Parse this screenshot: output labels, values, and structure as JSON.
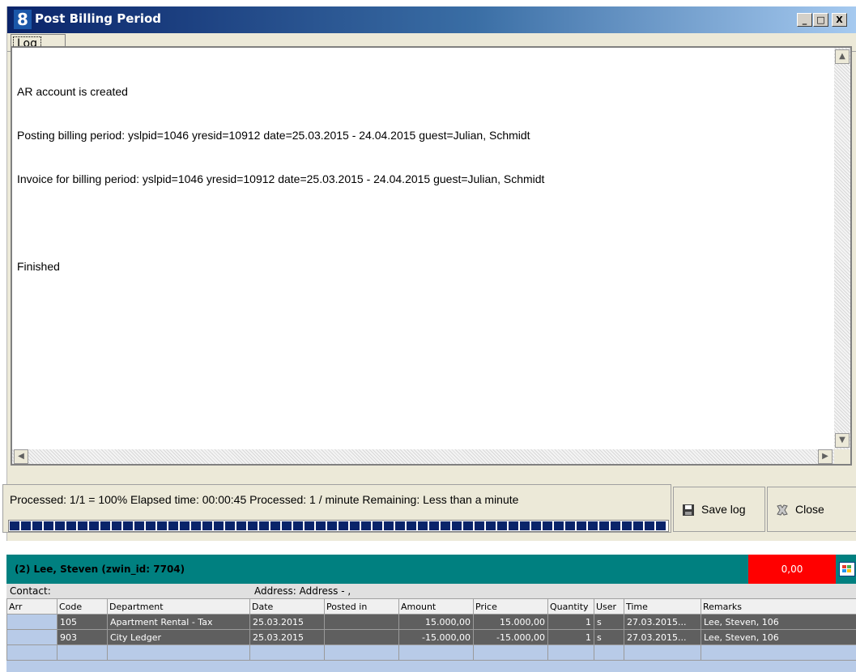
{
  "window": {
    "title": "Post Billing Period",
    "app_icon_text": "8",
    "controls": {
      "minimize": "_",
      "maximize": "□",
      "close": "X"
    }
  },
  "tabs": [
    {
      "label": "Log"
    }
  ],
  "log": {
    "lines": [
      "AR account is created",
      "Posting billing period: yslpid=1046 yresid=10912 date=25.03.2015 - 24.04.2015 guest=Julian, Schmidt",
      "Invoice for billing period: yslpid=1046 yresid=10912 date=25.03.2015 - 24.04.2015 guest=Julian, Schmidt",
      "",
      "Finished"
    ]
  },
  "status": {
    "text": "Processed: 1/1 = 100%  Elapsed time: 00:00:45  Processed: 1 / minute  Remaining: Less than a minute",
    "progress": 1.0
  },
  "buttons": {
    "save_log": "Save log",
    "close": "Close"
  },
  "account": {
    "header": "(2)  Lee, Steven (zwin_id: 7704)",
    "balance": "0,00",
    "contact_label": "Contact:",
    "address_label": "Address:  Address - ,"
  },
  "table": {
    "columns": [
      "Arr",
      "Code",
      "Department",
      "Date",
      "Posted in",
      "Amount",
      "Price",
      "Quantity",
      "User",
      "Time",
      "Remarks"
    ],
    "rows": [
      {
        "arr": "",
        "code": "105",
        "department": "Apartment Rental - Tax",
        "date": "25.03.2015",
        "posted_in": "",
        "amount": "15.000,00",
        "price": "15.000,00",
        "quantity": "1",
        "user": "s",
        "time": "27.03.2015...",
        "remarks": "Lee, Steven, 106"
      },
      {
        "arr": "",
        "code": "903",
        "department": "City Ledger",
        "date": "25.03.2015",
        "posted_in": "",
        "amount": "-15.000,00",
        "price": "-15.000,00",
        "quantity": "1",
        "user": "s",
        "time": "27.03.2015...",
        "remarks": "Lee, Steven, 106"
      }
    ]
  },
  "colors": {
    "title_bar": "#0a246a",
    "account_header": "#008080",
    "balance_bg": "#ff0000",
    "progress": "#0a246a"
  }
}
